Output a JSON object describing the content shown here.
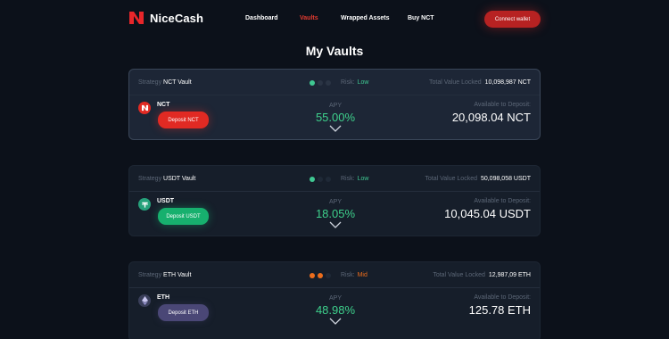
{
  "brand": {
    "name": "NiceCash",
    "accent": "#e23b30"
  },
  "nav": {
    "links": [
      {
        "label": "Dashboard",
        "active": false
      },
      {
        "label": "Vaults",
        "active": true
      },
      {
        "label": "Wrapped Assets",
        "active": false
      },
      {
        "label": "Buy NCT",
        "active": false
      }
    ],
    "connect_label": "Connect wallet"
  },
  "page_title": "My Vaults",
  "labels": {
    "strategy": "Strategy",
    "risk": "Risk:",
    "tvl": "Total Value Locked",
    "apy": "APY",
    "available": "Available to Deposit:"
  },
  "vaults": [
    {
      "name": "NCT Vault",
      "risk": "Low",
      "risk_color": "#3fc892",
      "tvl": "10,098,987 NCT",
      "coin": "NCT",
      "coin_icon": "nicecash-logo-icon",
      "deposit_label": "Deposit NCT",
      "apy": "55.00%",
      "available": "20,098.04 NCT"
    },
    {
      "name": "USDT Vault",
      "risk": "Low",
      "risk_color": "#3fc892",
      "tvl": "50,098,058 USDT",
      "coin": "USDT",
      "coin_icon": "tether-icon",
      "deposit_label": "Deposit USDT",
      "apy": "18.05%",
      "available": "10,045.04 USDT"
    },
    {
      "name": "ETH Vault",
      "risk": "Mid",
      "risk_color": "#ec6d1c",
      "tvl": "12,987,09 ETH",
      "coin": "ETH",
      "coin_icon": "ethereum-icon",
      "deposit_label": "Deposit ETH",
      "apy": "48.98%",
      "available": "125.78 ETH"
    }
  ]
}
